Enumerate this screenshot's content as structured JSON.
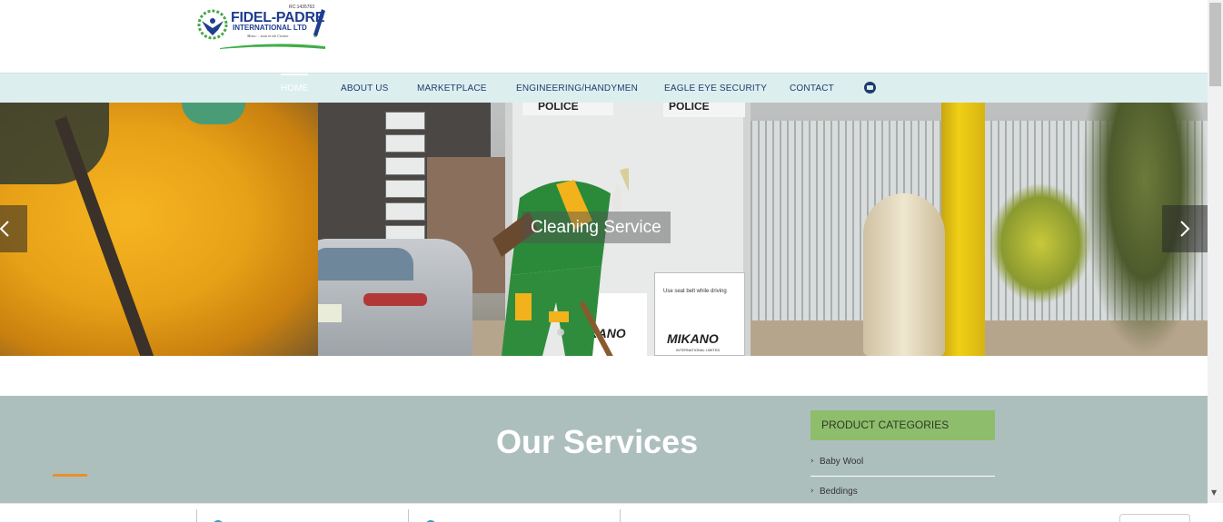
{
  "logo": {
    "reg": "RC:1435763",
    "name": "FIDEL-PADRE",
    "sub": "INTERNATIONAL LTD",
    "motto": "Motto: ...trust in the Creator"
  },
  "nav": {
    "items": [
      "HOME",
      "ABOUT US",
      "MARKETPLACE",
      "ENGINEERING/HANDYMEN",
      "EAGLE EYE SECURITY",
      "CONTACT"
    ],
    "active": "HOME",
    "cart_icon": "cart-icon"
  },
  "slider": {
    "caption": "Cleaning Service",
    "prev_icon": "chevron-left-icon",
    "next_icon": "chevron-right-icon",
    "dots": 2,
    "scene_text": {
      "police1": "POLICE",
      "police2": "POLICE",
      "mikano": "MIKANO",
      "mikano2": "MIKANO",
      "mikano_sub": "INTERNATIONAL LIMITED",
      "panel": "Use seat belt while driving"
    }
  },
  "services": {
    "title": "Our Services"
  },
  "sidebar": {
    "title": "PRODUCT CATEGORIES",
    "items": [
      "Baby Wool",
      "Beddings"
    ]
  },
  "colors": {
    "nav_bg": "#dcefee",
    "nav_text": "#1f3a6e",
    "services_bg": "#adbfbd",
    "category_header": "#8ebd6b",
    "accent_line": "#e88f2c"
  }
}
